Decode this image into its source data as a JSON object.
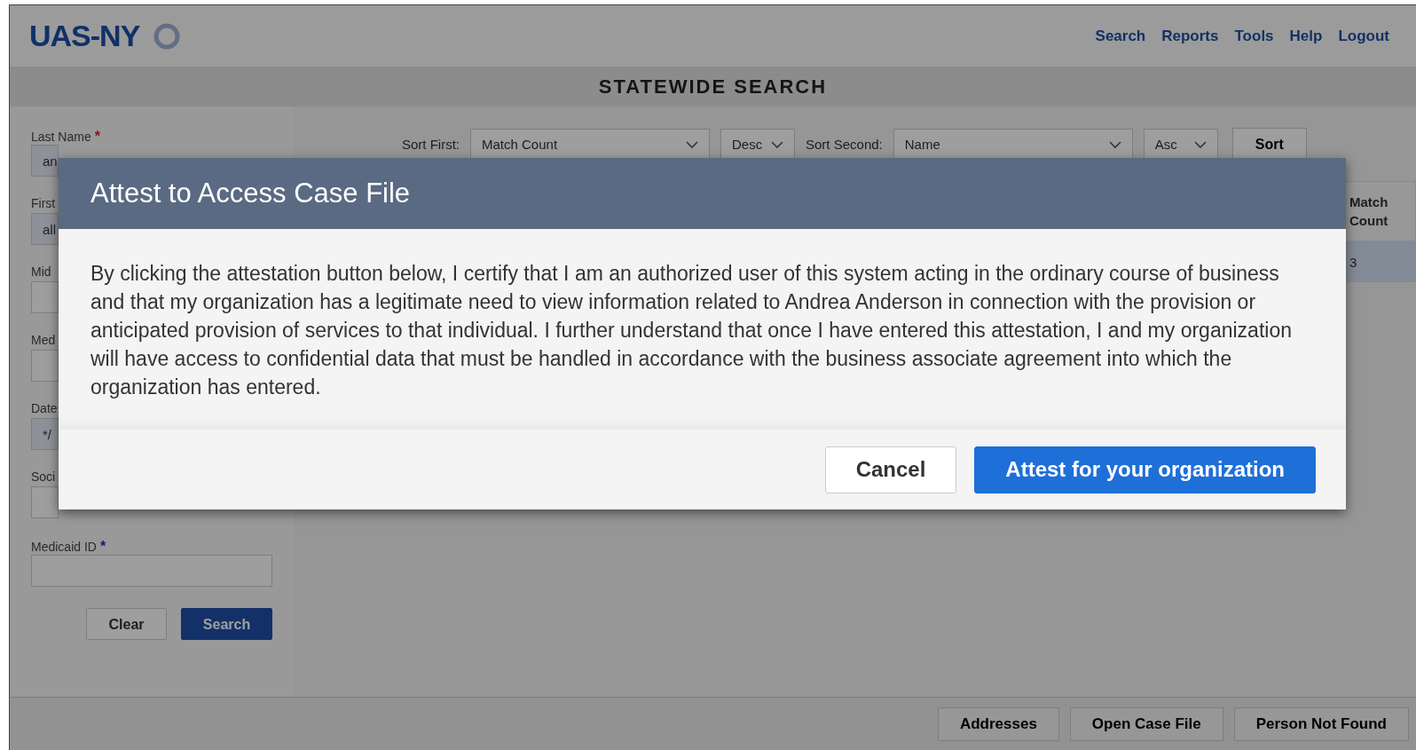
{
  "header": {
    "logo": "UAS-NY",
    "nav": [
      "Search",
      "Reports",
      "Tools",
      "Help",
      "Logout"
    ]
  },
  "page_title": "STATEWIDE SEARCH",
  "search_form": {
    "fields": [
      {
        "label": "Last Name",
        "mark": {
          "text": "*",
          "color": "#7a1e1e"
        },
        "value": "an"
      },
      {
        "label": "First",
        "value": "all"
      },
      {
        "label": "Mid"
      },
      {
        "label": "Med"
      },
      {
        "label": "Date",
        "value": "*/"
      },
      {
        "label": "Soci"
      },
      {
        "label": "Medicaid ID",
        "mark": {
          "text": "*",
          "color": "#141c6e"
        }
      }
    ],
    "buttons": [
      {
        "label": "Clear",
        "kind": "secondary"
      },
      {
        "label": "Search",
        "kind": "primary"
      }
    ]
  },
  "sort_bar": {
    "controls": [
      {
        "label": "Sort First:",
        "select": "Match Count"
      },
      {
        "select": "Desc"
      },
      {
        "label": "Sort Second:",
        "select": "Name"
      },
      {
        "select": "Asc"
      }
    ],
    "button": "Sort"
  },
  "results_table": {
    "columns": [
      "Match Count"
    ],
    "rows": [
      {
        "cells": [
          "3"
        ],
        "selected": true
      }
    ]
  },
  "footer_buttons": [
    "Addresses",
    "Open Case File",
    "Person Not Found"
  ],
  "modal": {
    "title": "Attest to Access Case File",
    "text": "By clicking the attestation button below, I certify that I am an authorized user of this system acting in the ordinary course of business and that my organization has a legitimate need to view information related to Andrea Anderson in connection with the provision or anticipated provision of services to that individual. I further understand that once I have entered this attestation, I and my organization will have access to confidential data that must be handled in accordance with the business associate agreement into which the organization has entered.",
    "buttons": [
      {
        "label": "Cancel",
        "kind": "secondary"
      },
      {
        "label": "Attest for your organization",
        "kind": "primary"
      }
    ]
  }
}
